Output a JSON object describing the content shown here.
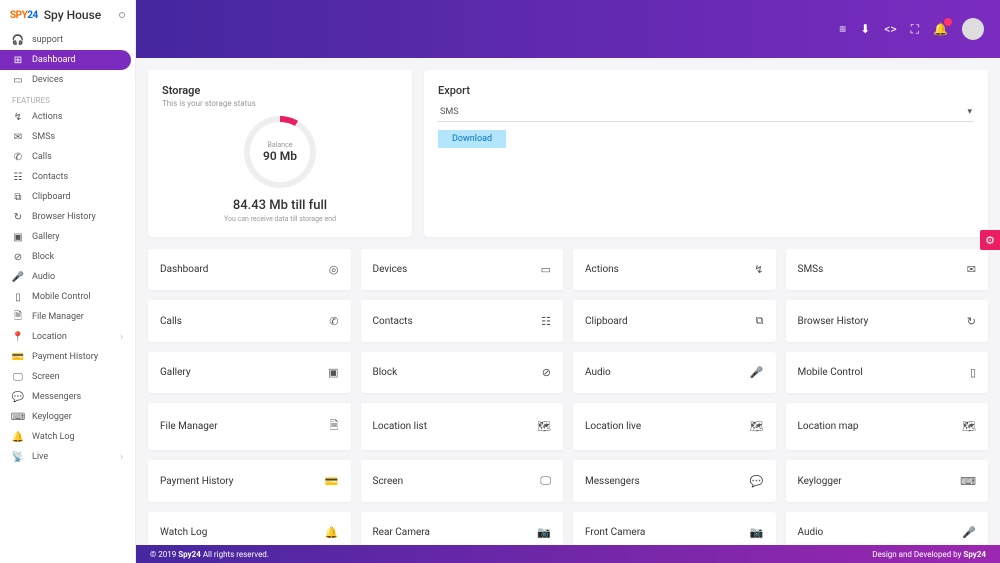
{
  "brand": {
    "logo_prefix": "SPY",
    "logo_suffix": "24",
    "name": "Spy House"
  },
  "sidebar": {
    "support": "support",
    "main": [
      {
        "label": "Dashboard",
        "icon": "⊞",
        "active": true
      },
      {
        "label": "Devices",
        "icon": "▭"
      }
    ],
    "features_label": "FEATURES",
    "features": [
      {
        "label": "Actions",
        "icon": "↯"
      },
      {
        "label": "SMSs",
        "icon": "✉"
      },
      {
        "label": "Calls",
        "icon": "✆"
      },
      {
        "label": "Contacts",
        "icon": "☷"
      },
      {
        "label": "Clipboard",
        "icon": "⧉"
      },
      {
        "label": "Browser History",
        "icon": "↻"
      },
      {
        "label": "Gallery",
        "icon": "▣"
      },
      {
        "label": "Block",
        "icon": "⊘"
      },
      {
        "label": "Audio",
        "icon": "🎤"
      },
      {
        "label": "Mobile Control",
        "icon": "▯"
      },
      {
        "label": "File Manager",
        "icon": "🗎"
      },
      {
        "label": "Location",
        "icon": "📍",
        "expandable": true
      },
      {
        "label": "Payment History",
        "icon": "💳"
      },
      {
        "label": "Screen",
        "icon": "🖵"
      },
      {
        "label": "Messengers",
        "icon": "💬"
      },
      {
        "label": "Keylogger",
        "icon": "⌨"
      },
      {
        "label": "Watch Log",
        "icon": "🔔"
      },
      {
        "label": "Live",
        "icon": "📡",
        "expandable": true
      }
    ]
  },
  "storage": {
    "title": "Storage",
    "subtitle": "This is your storage status",
    "balance_label": "Balance",
    "balance_value": "90 Mb",
    "till_full": "84.43 Mb till full",
    "till_sub": "You can receive data till storage end"
  },
  "export": {
    "title": "Export",
    "selected": "SMS",
    "download": "Download"
  },
  "tiles": [
    {
      "label": "Dashboard",
      "icon": "◎"
    },
    {
      "label": "Devices",
      "icon": "▭"
    },
    {
      "label": "Actions",
      "icon": "↯"
    },
    {
      "label": "SMSs",
      "icon": "✉"
    },
    {
      "label": "Calls",
      "icon": "✆"
    },
    {
      "label": "Contacts",
      "icon": "☷"
    },
    {
      "label": "Clipboard",
      "icon": "⧉"
    },
    {
      "label": "Browser History",
      "icon": "↻"
    },
    {
      "label": "Gallery",
      "icon": "▣"
    },
    {
      "label": "Block",
      "icon": "⊘"
    },
    {
      "label": "Audio",
      "icon": "🎤"
    },
    {
      "label": "Mobile Control",
      "icon": "▯"
    },
    {
      "label": "File Manager",
      "icon": "🗎"
    },
    {
      "label": "Location list",
      "icon": "🗺"
    },
    {
      "label": "Location live",
      "icon": "🗺"
    },
    {
      "label": "Location map",
      "icon": "🗺"
    },
    {
      "label": "Payment History",
      "icon": "💳"
    },
    {
      "label": "Screen",
      "icon": "🖵"
    },
    {
      "label": "Messengers",
      "icon": "💬"
    },
    {
      "label": "Keylogger",
      "icon": "⌨"
    },
    {
      "label": "Watch Log",
      "icon": "🔔"
    },
    {
      "label": "Rear Camera",
      "icon": "📷"
    },
    {
      "label": "Front Camera",
      "icon": "📷"
    },
    {
      "label": "Audio",
      "icon": "🎤"
    }
  ],
  "footer": {
    "left_prefix": "© 2019 ",
    "left_brand": "Spy24",
    "left_suffix": " All rights reserved.",
    "right_prefix": "Design and Developed by ",
    "right_brand": "Spy24"
  }
}
